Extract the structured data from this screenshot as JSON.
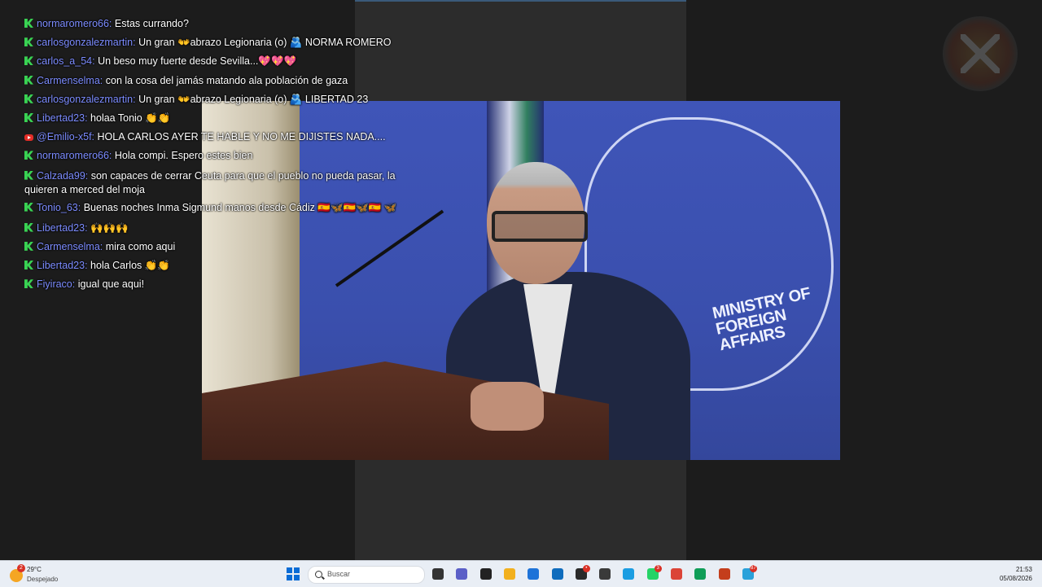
{
  "photo": {
    "sign_line1": "MINISTRY OF",
    "sign_line2": "FOREIGN AFFAIRS"
  },
  "chat": [
    {
      "source": "kick",
      "user": "normaromero66:",
      "text": "Estas currando?"
    },
    {
      "source": "kick",
      "user": "carlosgonzalezmartin:",
      "text": "Un gran 👐abrazo Legionaria (o) 🫂 NORMA ROMERO"
    },
    {
      "source": "kick",
      "user": "carlos_a_54:",
      "text": "Un beso muy fuerte desde Sevilla...💖💖💖"
    },
    {
      "source": "kick",
      "user": "Carmenselma:",
      "text": "con la cosa del jamás matando ala población de gaza"
    },
    {
      "source": "kick",
      "user": "carlosgonzalezmartin:",
      "text": "Un gran 👐abrazo Legionaria (o) 🫂 LIBERTAD 23"
    },
    {
      "source": "kick",
      "user": "Libertad23:",
      "text": "holaa Tonio 👏👏"
    },
    {
      "source": "youtube",
      "user": "@Emilio-x5f:",
      "text": "HOLA CARLOS AYER TE HABLE Y NO ME DIJISTES NADA...."
    },
    {
      "source": "kick",
      "user": "normaromero66:",
      "text": "Hola compi. Espero estes bien"
    },
    {
      "source": "kick",
      "user": "Calzada99:",
      "text": "son capaces de cerrar Ceuta para que el pueblo no pueda pasar, la quieren a merced del moja"
    },
    {
      "source": "kick",
      "user": "Tonio_63:",
      "text": "Buenas noches Inma Sigmund manos desde Cádiz 🇪🇸🦋🇪🇸🦋🇪🇸 🦋"
    },
    {
      "source": "kick",
      "user": "Libertad23:",
      "text": "🙌🙌🙌"
    },
    {
      "source": "kick",
      "user": "Carmenselma:",
      "text": "mira como aqui"
    },
    {
      "source": "kick",
      "user": "Libertad23:",
      "text": "hola Carlos 👏👏"
    },
    {
      "source": "kick",
      "user": "Fiyiraco:",
      "text": "igual que aqui!"
    }
  ],
  "taskbar": {
    "weather_badge": "2",
    "weather_temp": "29°C",
    "weather_desc": "Despejado",
    "search_placeholder": "Buscar",
    "clock_time": "21:53",
    "clock_date": "05/08/2026",
    "icons": [
      {
        "name": "task-view-icon",
        "color": "#333333",
        "badge": ""
      },
      {
        "name": "teams-icon",
        "color": "#5b5fc7",
        "badge": ""
      },
      {
        "name": "capcut-icon",
        "color": "#222222",
        "badge": ""
      },
      {
        "name": "file-explorer-icon",
        "color": "#f2b01e",
        "badge": ""
      },
      {
        "name": "microsoft-store-icon",
        "color": "#1e73d8",
        "badge": ""
      },
      {
        "name": "outlook-icon",
        "color": "#0f6cbd",
        "badge": ""
      },
      {
        "name": "obs-icon",
        "color": "#2a2a2a",
        "badge": "•"
      },
      {
        "name": "cube-app-icon",
        "color": "#3a3a3a",
        "badge": ""
      },
      {
        "name": "edge-icon",
        "color": "#1b9de2",
        "badge": ""
      },
      {
        "name": "whatsapp-icon",
        "color": "#25d366",
        "badge": "3"
      },
      {
        "name": "chrome-icon",
        "color": "#db4437",
        "badge": ""
      },
      {
        "name": "chrome-profile-icon",
        "color": "#0f9d58",
        "badge": ""
      },
      {
        "name": "powerpoint-icon",
        "color": "#c43e1c",
        "badge": ""
      },
      {
        "name": "telegram-icon",
        "color": "#2aa1da",
        "badge": "87"
      }
    ]
  }
}
